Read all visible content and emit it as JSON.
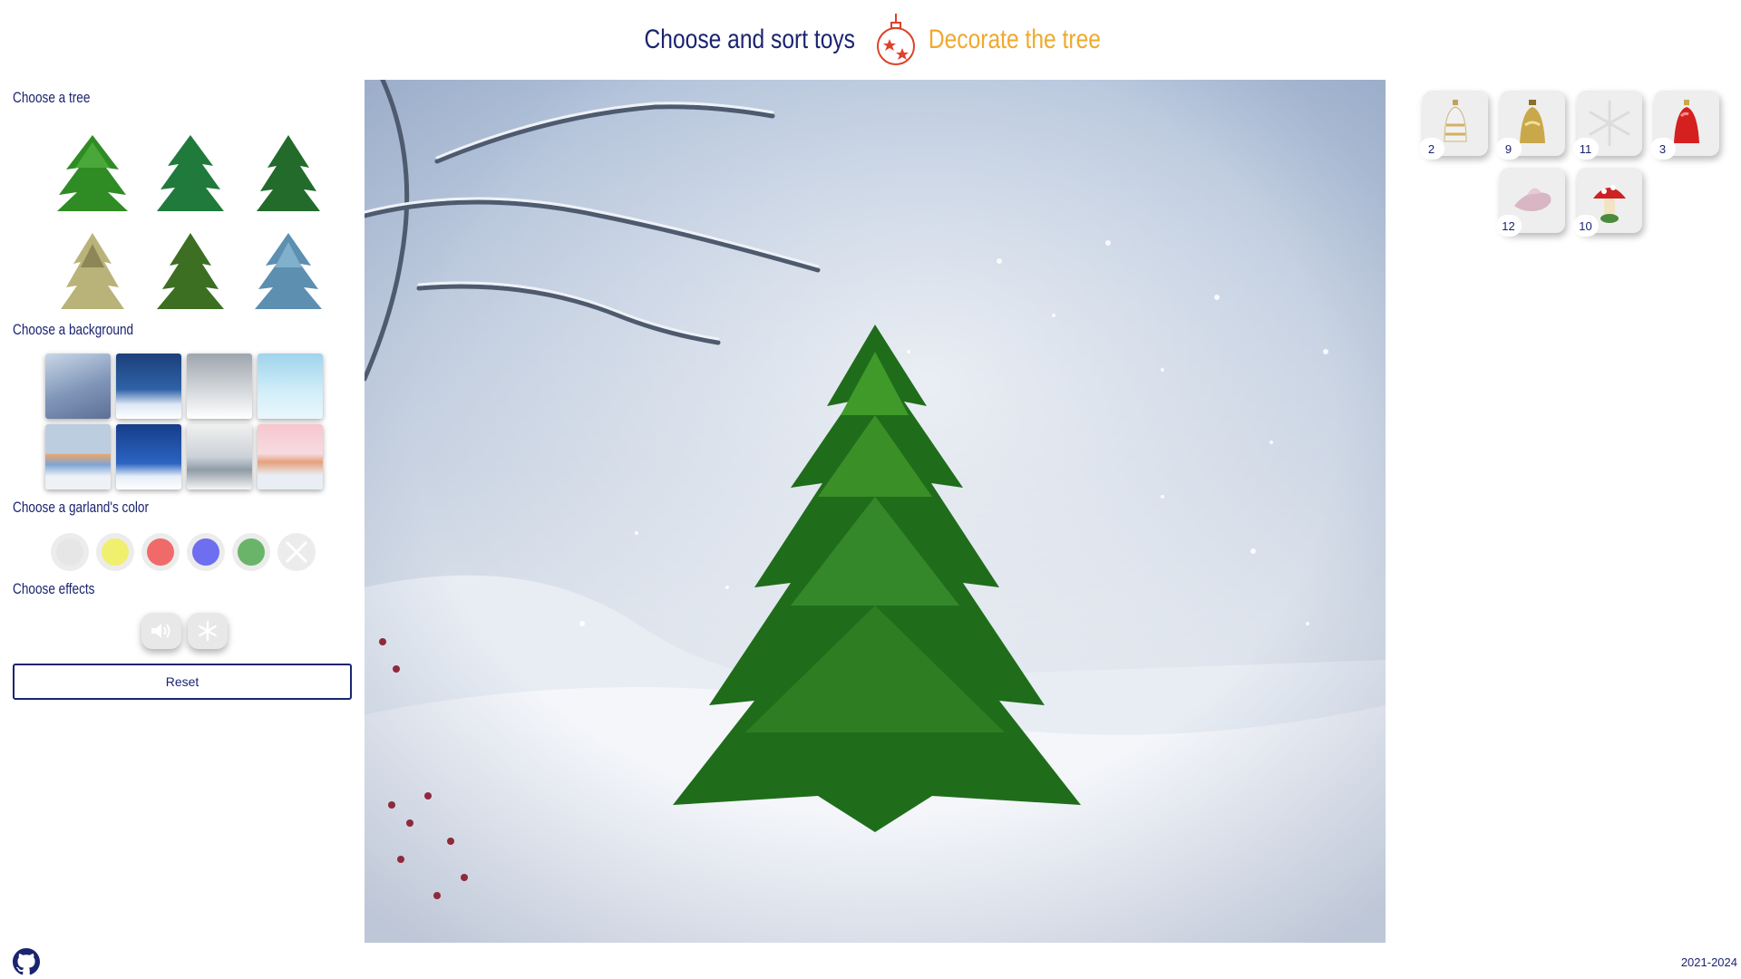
{
  "header": {
    "tab_toys": "Choose and sort toys",
    "tab_tree": "Decorate the tree",
    "ornament_icon": "ornament-icon",
    "active_color": "#f0a92c",
    "text_color": "#1b2470"
  },
  "sidebar": {
    "tree_title": "Choose a tree",
    "background_title": "Choose a background",
    "garland_title": "Choose a garland's color",
    "effects_title": "Choose effects",
    "reset_label": "Reset",
    "garland_colors": [
      "#e6e6e6",
      "#f1ef6e",
      "#f06a6a",
      "#6e6ef0",
      "#6ab46a"
    ],
    "effects": [
      "sound-icon",
      "snowflake-icon"
    ]
  },
  "toys": [
    {
      "id": "bell-white",
      "count": "2"
    },
    {
      "id": "bell-gold",
      "count": "9"
    },
    {
      "id": "snowflake",
      "count": "11"
    },
    {
      "id": "bell-red",
      "count": "3"
    },
    {
      "id": "bird-pink",
      "count": "12"
    },
    {
      "id": "mushroom",
      "count": "10"
    }
  ],
  "footer": {
    "github_icon": "github-icon",
    "year": "2021-2024"
  }
}
